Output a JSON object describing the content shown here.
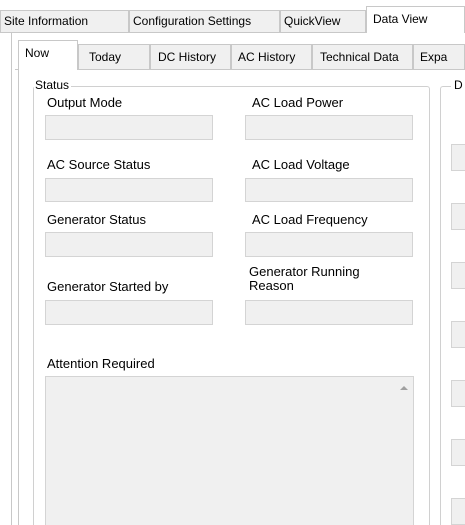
{
  "outer_tabs": [
    {
      "label": "Site Information"
    },
    {
      "label": "Configuration Settings"
    },
    {
      "label": "QuickView"
    },
    {
      "label": "Data View"
    }
  ],
  "inner_tabs": [
    {
      "label": "Now"
    },
    {
      "label": "Today"
    },
    {
      "label": "DC History"
    },
    {
      "label": "AC History"
    },
    {
      "label": "Technical Data"
    },
    {
      "label": "Expa"
    }
  ],
  "status": {
    "group_label": "Status",
    "output_mode": {
      "label": "Output Mode",
      "value": ""
    },
    "ac_source_status": {
      "label": "AC Source Status",
      "value": ""
    },
    "generator_status": {
      "label": "Generator Status",
      "value": ""
    },
    "generator_started_by": {
      "label": "Generator Started by",
      "value": ""
    },
    "ac_load_power": {
      "label": "AC Load Power",
      "value": ""
    },
    "ac_load_voltage": {
      "label": "AC Load Voltage",
      "value": ""
    },
    "ac_load_frequency": {
      "label": "AC Load Frequency",
      "value": ""
    },
    "generator_running_reason": {
      "label": "Generator Running Reason",
      "value": ""
    },
    "attention_required": {
      "label": "Attention Required",
      "value": ""
    }
  },
  "right_group": {
    "label": "D"
  }
}
